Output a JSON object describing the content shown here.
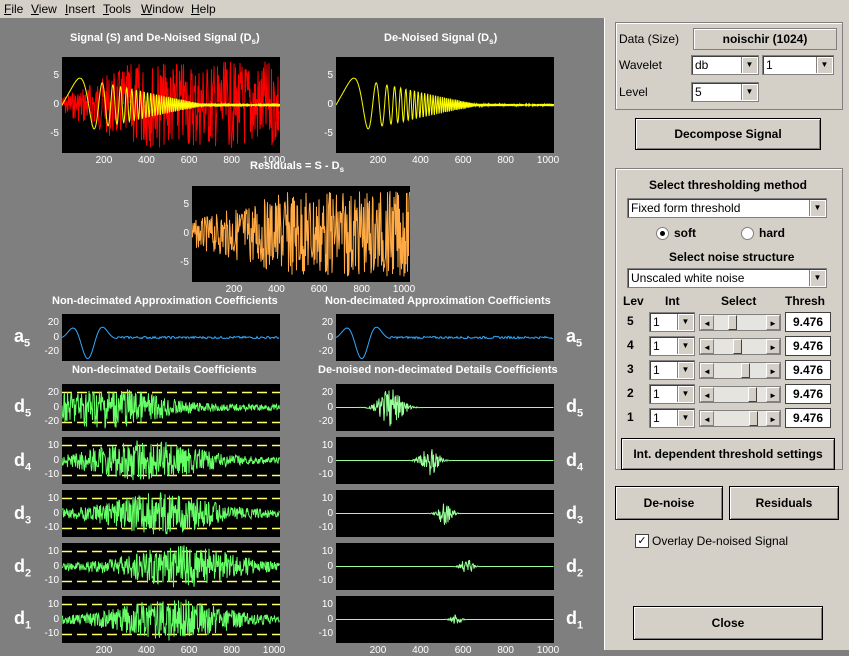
{
  "menu": [
    "File",
    "View",
    "Insert",
    "Tools",
    "Window",
    "Help"
  ],
  "titles": {
    "signal": "Signal (S) and De-Noised Signal (D",
    "signal_sub": "s",
    "denoised": "De-Noised Signal (D",
    "denoised_sub": "s",
    "residuals": "Residuals = S - D",
    "residuals_sub": "s",
    "approx_left": "Non-decimated Approximation Coefficients",
    "approx_right": "Non-decimated Approximation Coefficients",
    "details_left": "Non-decimated Details Coefficients",
    "details_right": "De-noised non-decimated Details Coefficients"
  },
  "x_ticks": [
    "200",
    "400",
    "600",
    "800",
    "1000"
  ],
  "signal_yticks": [
    "5",
    "0",
    "-5"
  ],
  "approx_yticks": [
    "20",
    "0",
    "-20"
  ],
  "detail_yticks": {
    "d5": [
      "20",
      "0",
      "-20"
    ],
    "d4": [
      "10",
      "0",
      "-10"
    ],
    "d3": [
      "10",
      "0",
      "-10"
    ],
    "d2": [
      "10",
      "0",
      "-10"
    ],
    "d1": [
      "10",
      "0",
      "-10"
    ]
  },
  "row_labels": [
    {
      "l": "a",
      "s": "5"
    },
    {
      "l": "d",
      "s": "5"
    },
    {
      "l": "d",
      "s": "4"
    },
    {
      "l": "d",
      "s": "3"
    },
    {
      "l": "d",
      "s": "2"
    },
    {
      "l": "d",
      "s": "1"
    }
  ],
  "panel": {
    "data_label": "Data  (Size)",
    "data_value": "noischir  (1024)",
    "wavelet_label": "Wavelet",
    "wavelet_family": "db",
    "wavelet_order": "1",
    "level_label": "Level",
    "level_value": "5",
    "decompose": "Decompose Signal",
    "select_method": "Select thresholding method",
    "method_value": "Fixed form threshold",
    "soft": "soft",
    "hard": "hard",
    "soft_selected": true,
    "noise_title": "Select noise structure",
    "noise_value": "Unscaled white noise",
    "hdr_lev": "Lev",
    "hdr_int": "Int",
    "hdr_select": "Select",
    "hdr_thresh": "Thresh",
    "levels": [
      {
        "lev": "5",
        "int": "1",
        "thresh": "9.476",
        "pos": 0.33
      },
      {
        "lev": "4",
        "int": "1",
        "thresh": "9.476",
        "pos": 0.45
      },
      {
        "lev": "3",
        "int": "1",
        "thresh": "9.476",
        "pos": 0.62
      },
      {
        "lev": "2",
        "int": "1",
        "thresh": "9.476",
        "pos": 0.78
      },
      {
        "lev": "1",
        "int": "1",
        "thresh": "9.476",
        "pos": 0.82
      }
    ],
    "int_dep": "Int. dependent threshold settings",
    "denoise": "De-noise",
    "residuals": "Residuals",
    "overlay": "Overlay De-noised Signal",
    "overlay_checked": true,
    "close": "Close"
  },
  "colors": {
    "signal": "#ff0000",
    "denoised": "#ffff00",
    "residual": "#ffaa44",
    "approx": "#33aaff",
    "detail": "#99ff99",
    "detail_orig": "#66ff66",
    "thresh": "#ffff66"
  }
}
